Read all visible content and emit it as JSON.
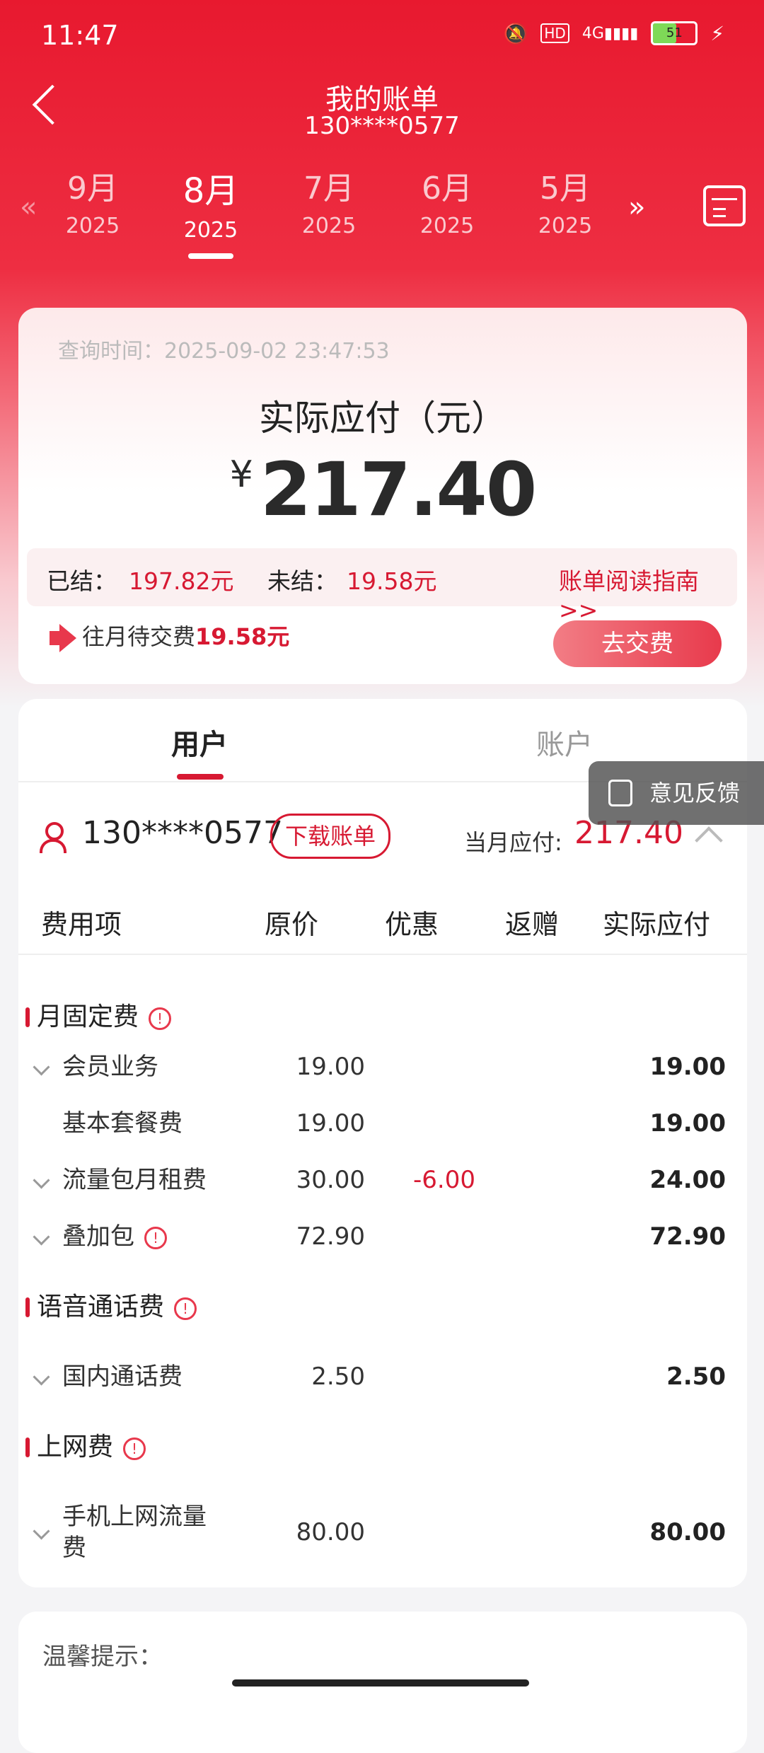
{
  "status": {
    "time": "11:47",
    "battery": "51"
  },
  "nav": {
    "title": "我的账单",
    "subtitle": "130****0577"
  },
  "months": [
    {
      "m": "9月",
      "y": "2025"
    },
    {
      "m": "8月",
      "y": "2025"
    },
    {
      "m": "7月",
      "y": "2025"
    },
    {
      "m": "6月",
      "y": "2025"
    },
    {
      "m": "5月",
      "y": "2025"
    }
  ],
  "summary": {
    "query_time": "查询时间：2025-09-02 23:47:53",
    "pay_label": "实际应付（元）",
    "currency": "¥",
    "amount": "217.40",
    "settled_label": "已结：",
    "settled_value": "197.82元",
    "unsettled_label": "未结：",
    "unsettled_value": "19.58元",
    "guide": "账单阅读指南>>",
    "notice_prefix": "往月待交费",
    "notice_value": "19.58元",
    "pay_button": "去交费"
  },
  "tabs": {
    "user": "用户",
    "account": "账户"
  },
  "feedback": "意见反馈",
  "user": {
    "phone": "130****0577",
    "download": "下载账单",
    "due_label": "当月应付:",
    "due_value": "217.40"
  },
  "table": {
    "headers": [
      "费用项",
      "原价",
      "优惠",
      "返赠",
      "实际应付"
    ],
    "sections": [
      {
        "title": "月固定费",
        "rows": [
          {
            "name": "会员业务",
            "orig": "19.00",
            "disc": "",
            "act": "19.00"
          },
          {
            "name": "基本套餐费",
            "orig": "19.00",
            "disc": "",
            "act": "19.00"
          },
          {
            "name": "流量包月租费",
            "orig": "30.00",
            "disc": "-6.00",
            "act": "24.00"
          },
          {
            "name": "叠加包",
            "orig": "72.90",
            "disc": "",
            "act": "72.90"
          }
        ]
      },
      {
        "title": "语音通话费",
        "rows": [
          {
            "name": "国内通话费",
            "orig": "2.50",
            "disc": "",
            "act": "2.50"
          }
        ]
      },
      {
        "title": "上网费",
        "rows": [
          {
            "name_line1": "手机上网流量",
            "name_line2": "费",
            "orig": "80.00",
            "disc": "",
            "act": "80.00"
          }
        ]
      }
    ]
  },
  "tips_title": "温馨提示："
}
